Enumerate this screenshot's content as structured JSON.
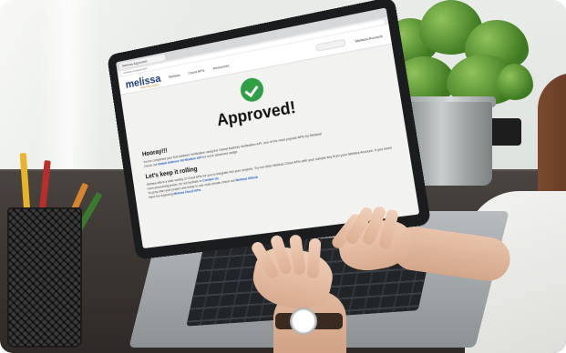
{
  "browser": {
    "tab_title": "Melissa Approved",
    "address": "melissa.com/approved"
  },
  "site_nav": {
    "logo": "melissa",
    "logo_sub": "HEALTHY DATA",
    "items": [
      "Melissa",
      "Cloud APIs",
      "Resources"
    ],
    "account": "Melissa Account"
  },
  "page": {
    "status_icon": "check-circle-icon",
    "status_color": "#2f9e44",
    "headline": "Approved!",
    "section1_heading": "Hooray!!!",
    "section1_text": "You've completed your first Address Verification using the Global Address Verification API, one of the most popular APIs by Melissa!",
    "section1_link_prefix": "Check out",
    "section1_link": "Global Address Verification API",
    "section1_link_suffix": "for more advanced usage.",
    "section2_heading": "Let's keep it rolling",
    "section2_text": "Melissa offers a wide variety of Cloud APIs for you to integrate into your projects. Try out other Melissa Cloud APIs with your sample key from your Melissa Account. If you need more processing power, do not hesitate to",
    "section2_link": "Contact Us",
    "section2_text2": "To jump start your project and ready to use code please check out",
    "section2_link2": "Melissa Github",
    "section2_text3": "Have fun exploring",
    "section2_link3": "Melissa Cloud APIs"
  }
}
